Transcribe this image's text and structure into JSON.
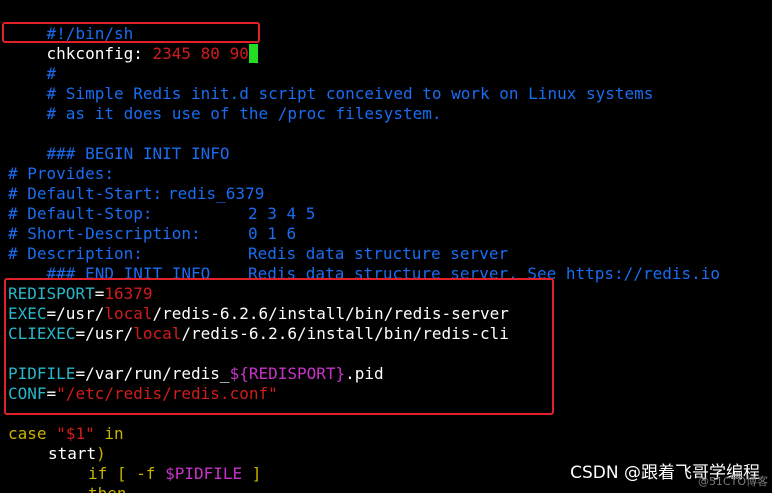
{
  "theme": {
    "background": "#000000",
    "comment_color": "#1a6cf0",
    "text_color": "#ffffff",
    "variable_color": "#27b7c8",
    "value_color": "#d21c1c",
    "expansion_color": "#c832c8",
    "keyword_color": "#c8b200",
    "cursor_color": "#22dd22",
    "highlight_box_color": "#e1202a"
  },
  "lines": {
    "l1": "#!/bin/sh",
    "l2_key": "chkconfig:",
    "l2_val": "2345 80 90",
    "l3": "#",
    "l4": "# Simple Redis init.d script conceived to work on Linux systems",
    "l5": "# as it does use of the /proc filesystem.",
    "l7": "### BEGIN INIT INFO",
    "l8_label": "# Provides:",
    "l8_value": "redis_6379",
    "l9_label": "# Default-Start:",
    "l9_value": "2 3 4 5",
    "l10_label": "# Default-Stop:",
    "l10_value": "0 1 6",
    "l11_label": "# Short-Description:",
    "l11_value": "Redis data structure server",
    "l12_label": "# Description:",
    "l12_value": "Redis data structure server. See https://redis.io",
    "l13": "### END INIT INFO",
    "l15_var": "REDISPORT",
    "l15_eq": "=",
    "l15_val": "16379",
    "l16_var": "EXEC",
    "l16_a": "=/usr/",
    "l16_b": "local",
    "l16_c": "/redis-6.2.6/install/bin/redis-server",
    "l17_var": "CLIEXEC",
    "l17_a": "=/usr/",
    "l17_b": "local",
    "l17_c": "/redis-6.2.6/install/bin/redis-cli",
    "l19_var": "PIDFILE",
    "l19_a": "=/var/run/redis_",
    "l19_b": "${REDISPORT}",
    "l19_c": ".pid",
    "l20_var": "CONF",
    "l20_eq": "=",
    "l20_val": "\"/etc/redis/redis.conf\"",
    "l22_kw": "case",
    "l22_sp": " ",
    "l22_str": "\"$1\"",
    "l22_sp2": " ",
    "l22_in": "in",
    "l23_a": "start",
    "l23_b": ")",
    "l24_if": "if",
    "l24_a": " [ ",
    "l24_flag": "-f",
    "l24_sp": " ",
    "l24_var": "$PIDFILE",
    "l24_b": " ]",
    "l25": "then"
  },
  "watermark": {
    "text": "CSDN @跟着飞哥学编程",
    "shadow": "@51CTO博客"
  }
}
